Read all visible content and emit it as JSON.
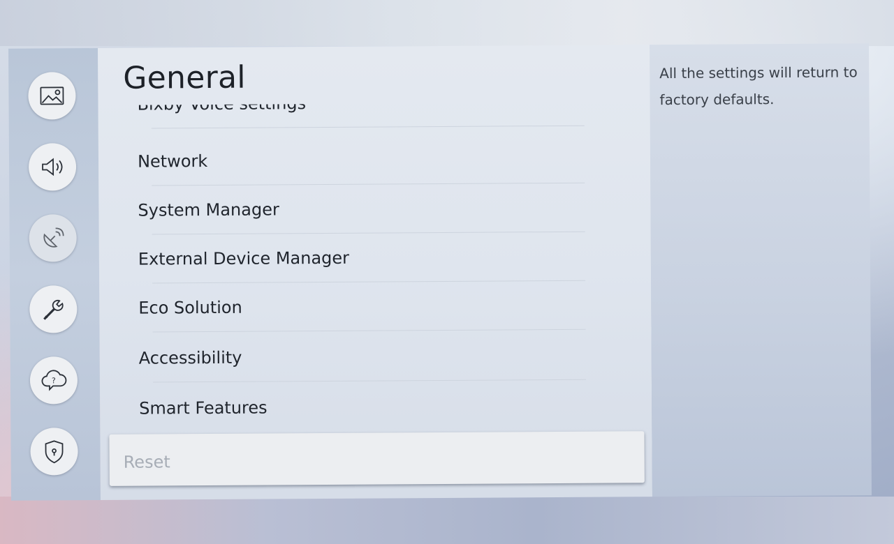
{
  "screen": {
    "title": "General"
  },
  "sidebar": {
    "items": [
      {
        "name": "picture",
        "icon": "picture-icon"
      },
      {
        "name": "sound",
        "icon": "speaker-icon"
      },
      {
        "name": "broadcasting",
        "icon": "satellite-dish-icon"
      },
      {
        "name": "general",
        "icon": "wrench-icon"
      },
      {
        "name": "support",
        "icon": "cloud-question-icon"
      },
      {
        "name": "privacy",
        "icon": "shield-lock-icon"
      }
    ]
  },
  "menu": {
    "items": [
      {
        "label": "Bixby Voice settings"
      },
      {
        "label": "Network"
      },
      {
        "label": "System Manager"
      },
      {
        "label": "External Device Manager"
      },
      {
        "label": "Eco Solution"
      },
      {
        "label": "Accessibility"
      },
      {
        "label": "Smart Features"
      }
    ],
    "focused": {
      "label": "Reset"
    }
  },
  "info": {
    "description": "All the settings will return to factory defaults."
  },
  "colors": {
    "title": "#1d2128",
    "item_text": "#1f242c",
    "focused_bg": "#eceef1",
    "focused_text": "#a7adb6",
    "icon_stroke": "#2b3038"
  }
}
